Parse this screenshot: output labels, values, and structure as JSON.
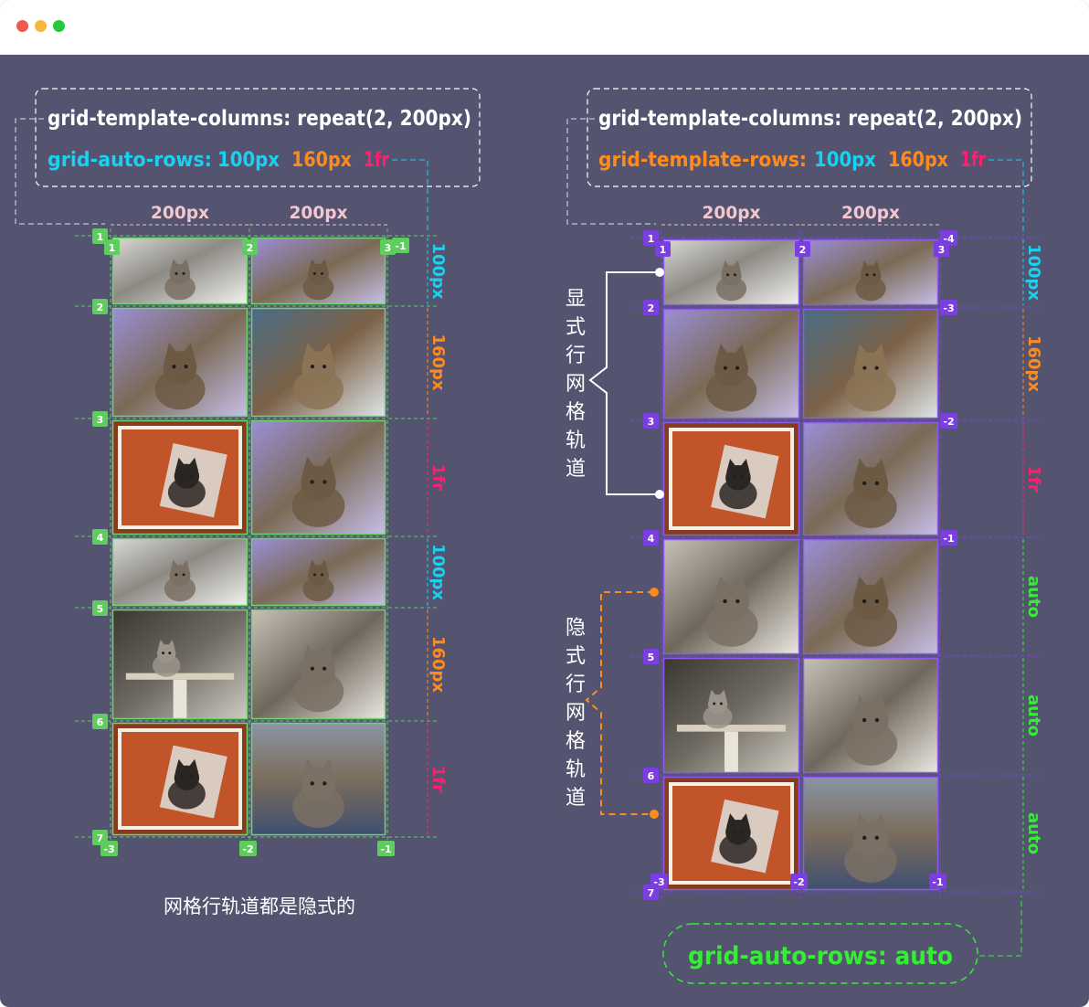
{
  "window": {
    "controls": [
      "close-button",
      "minimize-button",
      "maximize-button"
    ],
    "colors": {
      "close": "#ee5a4c",
      "minimize": "#f6b73c",
      "maximize": "#27c840"
    }
  },
  "colors": {
    "background": "#545470",
    "cyan": "#19d1f0",
    "orange": "#ff8a1e",
    "pink": "#ff1f6e",
    "green": "#33ee33",
    "leftMarker": "#5fcc5f",
    "rightMarker": "#7b3fe0",
    "white": "#ffffff"
  },
  "left": {
    "code": {
      "line1": "grid-template-columns: repeat(2, 200px)",
      "line2": {
        "prop": "grid-auto-rows:",
        "v1": "100px",
        "v2": "160px",
        "v3": "1fr"
      }
    },
    "col_labels": [
      "200px",
      "200px"
    ],
    "row_labels": [
      "100px",
      "160px",
      "1fr",
      "100px",
      "160px",
      "1fr"
    ],
    "row_numbers": [
      "1",
      "2",
      "3",
      "4",
      "5",
      "6",
      "7"
    ],
    "top_col_numbers": [
      "1",
      "2",
      "3",
      "-1"
    ],
    "bottom_col_numbers": [
      "-3",
      "-2",
      "-1"
    ],
    "caption": "网格行轨道都是隐式的",
    "images": [
      "kitten-photo",
      "cats-painting",
      "cats-painting",
      "man-with-cat-photo",
      "framed-cat-collage",
      "cats-painting",
      "kitten-photo",
      "cats-painting",
      "kitten-on-cat-tree-photo",
      "tabby-cat-sitting-photo",
      "framed-cat-collage",
      "cat-on-blanket-photo"
    ]
  },
  "right": {
    "code": {
      "line1": "grid-template-columns: repeat(2, 200px)",
      "line2": {
        "prop": "grid-template-rows:",
        "v1": "100px",
        "v2": "160px",
        "v3": "1fr"
      }
    },
    "col_labels": [
      "200px",
      "200px"
    ],
    "row_labels": [
      "100px",
      "160px",
      "1fr",
      "auto",
      "auto",
      "auto"
    ],
    "row_numbers": [
      "1",
      "2",
      "3",
      "4",
      "5",
      "6",
      "7"
    ],
    "row_numbers_neg": [
      "-4",
      "-3",
      "-2",
      "-1"
    ],
    "top_col_numbers": [
      "1",
      "2",
      "3"
    ],
    "bottom_col_numbers": [
      "-3",
      "-2",
      "-1"
    ],
    "explicit_label": "显式行网格轨道",
    "implicit_label": "隐式行网格轨道",
    "auto_rows_note": "grid-auto-rows: auto",
    "images": [
      "kitten-photo",
      "cats-painting",
      "cats-painting",
      "man-with-cat-photo",
      "framed-cat-collage",
      "cats-painting",
      "tabby-cat-sitting-photo",
      "cats-painting",
      "kitten-on-cat-tree-photo",
      "tabby-cat-sitting-photo",
      "framed-cat-collage",
      "cat-on-blanket-photo"
    ]
  }
}
